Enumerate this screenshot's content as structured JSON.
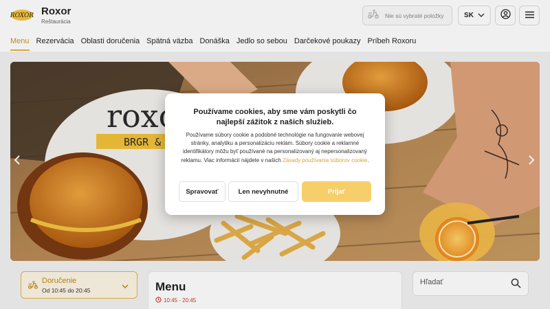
{
  "brand": {
    "logo_text": "ROXOR",
    "name": "Roxor",
    "subtitle": "Reštaurácia"
  },
  "header": {
    "cart_label": "Nie sú vybraté položky",
    "language": "SK",
    "icons": {
      "cart": "scooter-icon",
      "language_toggle": "chevron-down-icon",
      "account": "user-icon",
      "menu": "hamburger-icon"
    }
  },
  "nav": {
    "items": [
      {
        "label": "Menu",
        "active": true
      },
      {
        "label": "Rezervácia",
        "active": false
      },
      {
        "label": "Oblasti doručenia",
        "active": false
      },
      {
        "label": "Spätná väzba",
        "active": false
      },
      {
        "label": "Donáška",
        "active": false
      },
      {
        "label": "Jedlo so sebou",
        "active": false
      },
      {
        "label": "Darčekové poukazy",
        "active": false
      },
      {
        "label": "Príbeh Roxoru",
        "active": false
      }
    ]
  },
  "hero": {
    "sign_text_top": "roxo",
    "sign_text_bottom": "BRGR &",
    "prev_icon": "chevron-left-icon",
    "next_icon": "chevron-right-icon"
  },
  "delivery": {
    "title": "Doručenie",
    "hours": "Od 10:45 do 20:45"
  },
  "menu_section": {
    "title": "Menu",
    "hours": "10:45 - 20:45"
  },
  "search": {
    "placeholder": "Hľadať"
  },
  "cookie_modal": {
    "title": "Používame cookies, aby sme vám poskytli čo najlepší zážitok z našich služieb.",
    "body": "Používame súbory cookie a podobné technológie na fungovanie webovej stránky, analytiku a personalizáciu reklám. Súbory cookie a reklamné identifikátory môžu byť používané na personalizovaný aj nepersonalizovaný reklamu. Viac informácií nájdete v našich ",
    "link_text": "Zásady používania súborov cookie",
    "body_end": ".",
    "buttons": {
      "manage": "Spravovať",
      "necessary": "Len nevyhnutné",
      "accept": "Prijať"
    }
  },
  "colors": {
    "accent": "#e4b23c",
    "accept_button": "#f7cf6a",
    "link": "#d9a23a",
    "hours_red": "#c0392b"
  }
}
